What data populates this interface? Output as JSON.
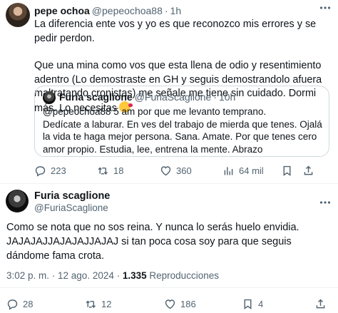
{
  "reply_tweet": {
    "author_name": "pepe ochoa",
    "handle": "@pepeochoa88",
    "dot": "·",
    "time": "1h",
    "text_p1": "La diferencia ente vos y yo es que reconozco mis errores y se pedir perdon.",
    "text_p2": "Que una mina como vos que esta llena de odio y resentimiento adentro (Lo demostraste en GH y seguis demostrandolo afuera maltratando cronistas) me señale me tiene sin cuidado. Dormi más. Lo necesitas",
    "emoji": "face-blowing-a-kiss",
    "quoted": {
      "author_name": "Furia scaglione",
      "handle": "@FuriaScaglione",
      "dot": "·",
      "time": "10h",
      "text": "@pepeochoa88  5 am por que me levanto temprano.\nDedícate a laburar. En ves del trabajo de mierda que tenes. Ojalá la vida te haga mejor persona. Sana. Amate. Por que tenes cero amor propio. Estudia, lee, entrena la mente. Abrazo"
    },
    "actions": {
      "replies": "223",
      "retweets": "18",
      "likes": "360",
      "views": "64 mil"
    }
  },
  "main_tweet": {
    "author_name": "Furia scaglione",
    "handle": "@FuriaScaglione",
    "text": "Como se nota que no sos reina. Y nunca lo serás huelo envidia. JAJAJAJJAJAJAJJAJAJ si tan poca cosa soy para que seguis dándome fama crota.",
    "time_date": "3:02 p. m. · 12 ago. 2024 · ",
    "views_count": "1.335",
    "views_label": " Reproducciones",
    "actions": {
      "replies": "28",
      "retweets": "12",
      "likes": "186",
      "bookmarks": "4"
    }
  }
}
